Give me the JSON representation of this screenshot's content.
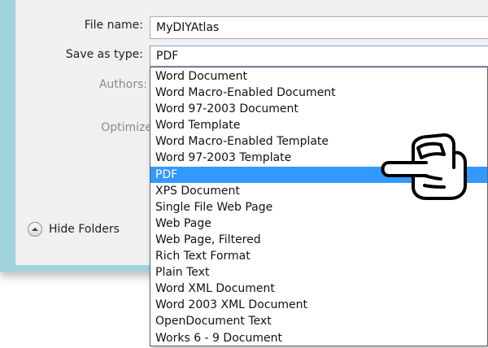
{
  "dialog": {
    "file_name_label": "File name:",
    "file_name_value": "MyDIYAtlas",
    "save_as_type_label": "Save as type:",
    "save_as_type_value": "PDF",
    "authors_label": "Authors:",
    "optimize_label": "Optimize",
    "hide_folders_label": "Hide Folders"
  },
  "type_list": {
    "items": [
      "Word Document",
      "Word Macro-Enabled Document",
      "Word 97-2003 Document",
      "Word Template",
      "Word Macro-Enabled Template",
      "Word 97-2003 Template",
      "PDF",
      "XPS Document",
      "Single File Web Page",
      "Web Page",
      "Web Page, Filtered",
      "Rich Text Format",
      "Plain Text",
      "Word XML Document",
      "Word 2003 XML Document",
      "OpenDocument Text",
      "Works 6 - 9 Document"
    ],
    "selected_index": 6
  },
  "overlay": {
    "pointer_icon": "pointing-hand-icon"
  },
  "colors": {
    "selection": "#3399ff",
    "window_frame": "#9fd3dd",
    "dialog_background": "#f0f0f0"
  }
}
